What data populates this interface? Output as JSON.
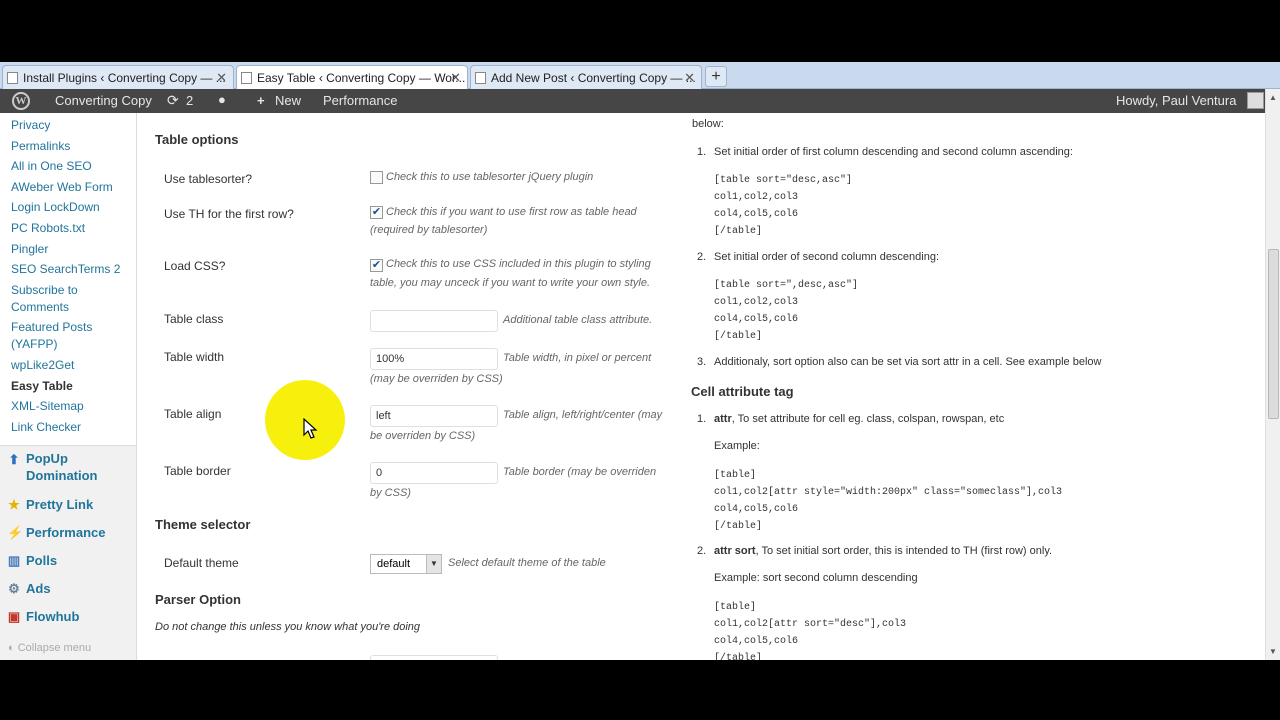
{
  "browser": {
    "tabs": [
      {
        "title": "Install Plugins ‹ Converting Copy — ..."
      },
      {
        "title": "Easy Table ‹ Converting Copy — Wor..."
      },
      {
        "title": "Add New Post ‹ Converting Copy — ..."
      }
    ],
    "new_tab": "+",
    "close": "✕"
  },
  "adminbar": {
    "site": "Converting Copy",
    "updates": "2",
    "new": "New",
    "performance": "Performance",
    "howdy": "Howdy, Paul Ventura"
  },
  "sidebar": {
    "subitems": [
      "Privacy",
      "Permalinks",
      "All in One SEO",
      "AWeber Web Form",
      "Login LockDown",
      "PC Robots.txt",
      "Pingler",
      "SEO SearchTerms 2",
      "Subscribe to Comments",
      "Featured Posts (YAFPP)",
      "wpLike2Get",
      "Easy Table",
      "XML-Sitemap",
      "Link Checker"
    ],
    "current": "Easy Table",
    "menu": [
      {
        "label": "PopUp Domination",
        "icon": "arrow-up-icon"
      },
      {
        "label": "Pretty Link",
        "icon": "star-icon"
      },
      {
        "label": "Performance",
        "icon": "performance-icon"
      },
      {
        "label": "Polls",
        "icon": "polls-icon"
      },
      {
        "label": "Ads",
        "icon": "ads-icon"
      },
      {
        "label": "Flowhub",
        "icon": "flowhub-icon"
      }
    ],
    "collapse": "Collapse menu"
  },
  "options": {
    "table_options_heading": "Table options",
    "use_tablesorter": {
      "label": "Use tablesorter?",
      "desc": "Check this to use tablesorter jQuery plugin",
      "checked": false
    },
    "use_th": {
      "label": "Use TH for the first row?",
      "desc1": "Check this if you want to use first row as table head",
      "desc2": "(required by tablesorter)",
      "checked": true
    },
    "load_css": {
      "label": "Load CSS?",
      "desc1": "Check this to use CSS included in this plugin to styling",
      "desc2": "table, you may unceck if you want to write your own style.",
      "checked": true
    },
    "table_class": {
      "label": "Table class",
      "value": "",
      "desc": "Additional table class attribute."
    },
    "table_width": {
      "label": "Table width",
      "value": "100%",
      "desc1": "Table width, in pixel or percent",
      "desc2": "(may be overriden by CSS)"
    },
    "table_align": {
      "label": "Table align",
      "value": "left",
      "desc1": "Table align, left/right/center (may",
      "desc2": "be overriden by CSS)"
    },
    "table_border": {
      "label": "Table border",
      "value": "0",
      "desc1": "Table border (may be overriden",
      "desc2": "by CSS)"
    },
    "theme_heading": "Theme selector",
    "default_theme": {
      "label": "Default theme",
      "value": "default",
      "desc": "Select default theme of the table"
    },
    "parser_heading": "Parser Option",
    "parser_note": "Do not change this unless you know what you're doing"
  },
  "help": {
    "below": "below:",
    "items1": [
      {
        "num": "1.",
        "text": "Set initial order of first column descending and second column ascending:",
        "code": [
          "[table sort=\"desc,asc\"]",
          "col1,col2,col3",
          "col4,col5,col6",
          "[/table]"
        ]
      },
      {
        "num": "2.",
        "text": "Set initial order of second column descending:",
        "code": [
          "[table sort=\",desc,asc\"]",
          "col1,col2,col3",
          "col4,col5,col6",
          "[/table]"
        ]
      },
      {
        "num": "3.",
        "text": "Additionaly, sort option also can be set via sort attr in a cell. See example below"
      }
    ],
    "cell_heading": "Cell attribute tag",
    "attr": {
      "num": "1.",
      "name": "attr",
      "text": ", To set attribute for cell eg. class, colspan, rowspan, etc",
      "example": "Example:",
      "code": [
        "[table]",
        "col1,col2[attr style=\"width:200px\" class=\"someclass\"],col3",
        "col4,col5,col6",
        "[/table]"
      ]
    },
    "attr_sort": {
      "num": "2.",
      "name": "attr sort",
      "text": ", To set initial sort order, this is intended to TH (first row) only.",
      "example": "Example: sort second column descending",
      "code": [
        "[table]",
        "col1,col2[attr sort=\"desc\"],col3",
        "col4,col5,col6",
        "[/table]"
      ]
    }
  }
}
